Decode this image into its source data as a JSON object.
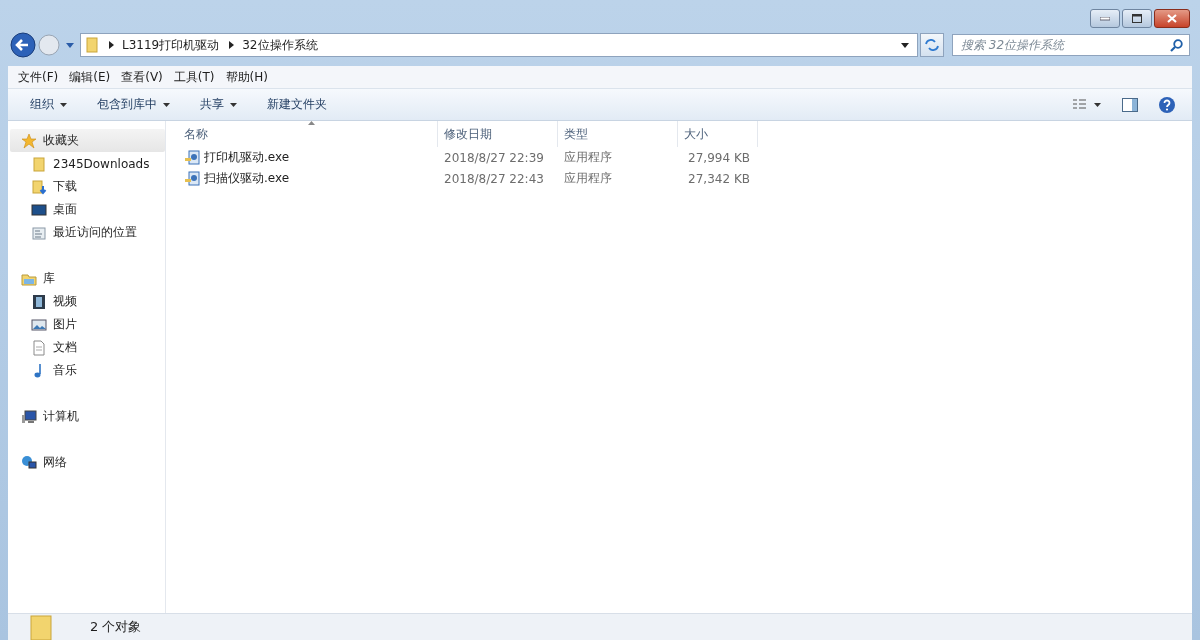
{
  "address_bar": {
    "path": [
      "L3119打印机驱动",
      "32位操作系统"
    ]
  },
  "search": {
    "placeholder": "搜索 32位操作系统"
  },
  "menu_bar": [
    "文件(F)",
    "编辑(E)",
    "查看(V)",
    "工具(T)",
    "帮助(H)"
  ],
  "toolbar": [
    {
      "label": "组织",
      "dropdown": true
    },
    {
      "label": "包含到库中",
      "dropdown": true
    },
    {
      "label": "共享",
      "dropdown": true
    },
    {
      "label": "新建文件夹",
      "dropdown": false
    }
  ],
  "sidebar": {
    "groups": [
      {
        "label": "收藏夹",
        "selected": true,
        "children": [
          {
            "label": "2345Downloads",
            "selected": false
          },
          {
            "label": "下载",
            "selected": false
          },
          {
            "label": "桌面",
            "selected": false
          },
          {
            "label": "最近访问的位置",
            "selected": false
          }
        ]
      },
      {
        "label": "库",
        "selected": false,
        "children": [
          {
            "label": "视频",
            "selected": false
          },
          {
            "label": "图片",
            "selected": false
          },
          {
            "label": "文档",
            "selected": false
          },
          {
            "label": "音乐",
            "selected": false
          }
        ]
      },
      {
        "label": "计算机",
        "selected": false
      },
      {
        "label": "网络",
        "selected": false
      }
    ]
  },
  "table": {
    "columns": [
      {
        "label": "名称",
        "sorted": true
      },
      {
        "label": "修改日期",
        "sorted": false
      },
      {
        "label": "类型",
        "sorted": false
      },
      {
        "label": "大小",
        "sorted": false
      }
    ],
    "rows": [
      {
        "name": "打印机驱动.exe",
        "date": "2018/8/27 22:39",
        "type": "应用程序",
        "size": "27,994 KB"
      },
      {
        "name": "扫描仪驱动.exe",
        "date": "2018/8/27 22:43",
        "type": "应用程序",
        "size": "27,342 KB"
      }
    ]
  },
  "status_bar": {
    "text": "2 个对象"
  }
}
